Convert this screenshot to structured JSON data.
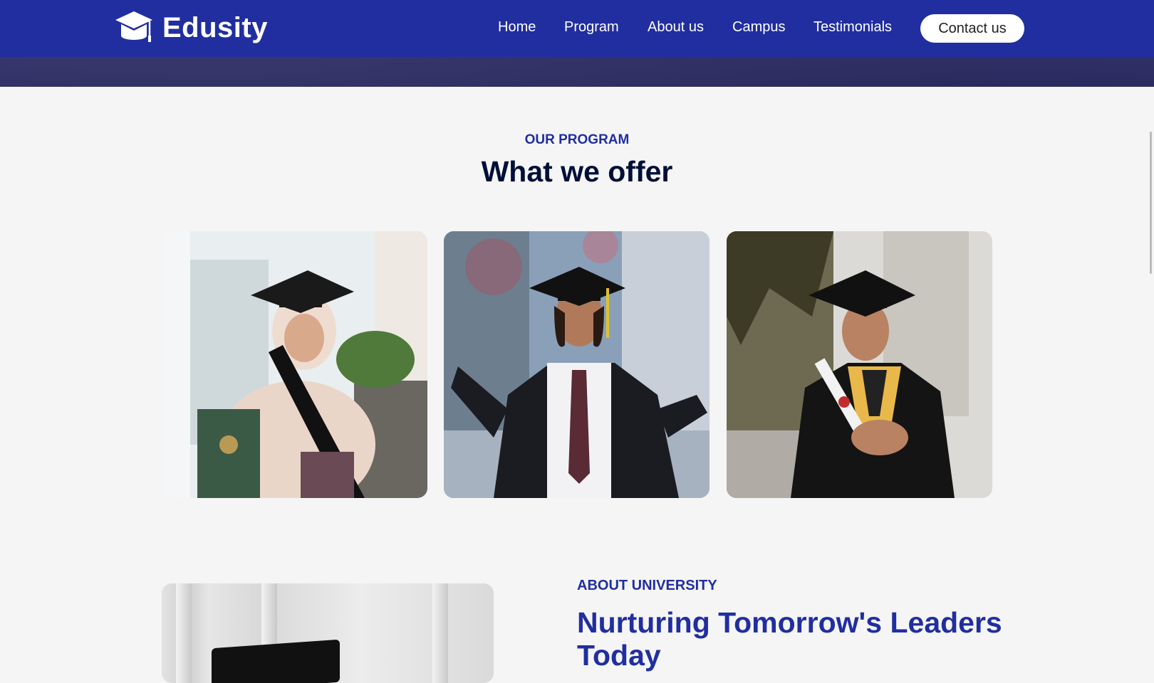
{
  "brand": {
    "name": "Edusity",
    "logo_icon": "graduation-cap-icon"
  },
  "nav": {
    "items": [
      {
        "label": "Home"
      },
      {
        "label": "Program"
      },
      {
        "label": "About us"
      },
      {
        "label": "Campus"
      },
      {
        "label": "Testimonials"
      }
    ],
    "cta_label": "Contact us"
  },
  "program": {
    "subtitle": "OUR PROGRAM",
    "title": "What we offer",
    "cards": [
      {
        "image": "graduate-woman-hijab-photo"
      },
      {
        "image": "graduate-man-arms-open-photo"
      },
      {
        "image": "graduate-man-diploma-photo"
      }
    ]
  },
  "about": {
    "subtitle": "ABOUT UNIVERSITY",
    "title": "Nurturing Tomorrow's Leaders Today"
  },
  "colors": {
    "primary": "#212ea0",
    "heading": "#000f38",
    "background": "#f5f5f5"
  }
}
